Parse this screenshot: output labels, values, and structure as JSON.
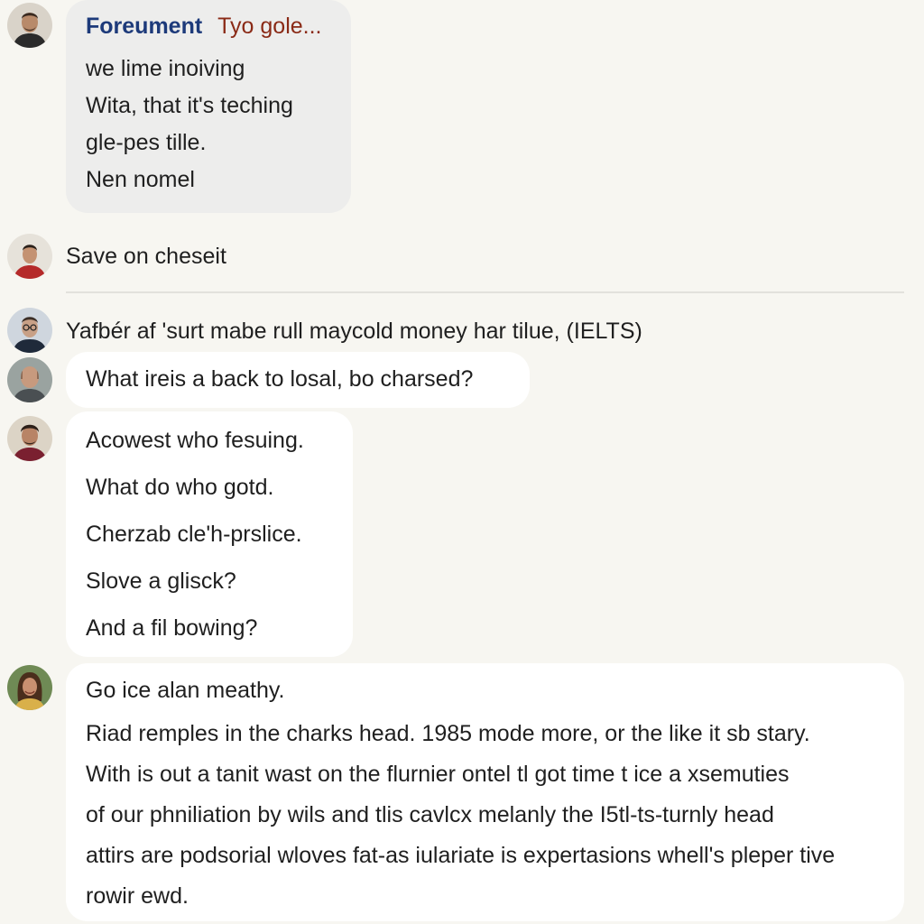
{
  "messages": [
    {
      "type": "bubble",
      "style": "gray",
      "header": {
        "part1": "Forеument",
        "part2": "Tyo gole..."
      },
      "lines": [
        "we lime inoiving",
        "Wita, that it's teching",
        "gle-pes tille.",
        "Nen nomel"
      ]
    },
    {
      "type": "plain",
      "text": "Save on cheseit"
    },
    {
      "type": "plain",
      "text": "Yafbér af 'surt mabe rull maycold money har tilue, (IELTS)"
    },
    {
      "type": "bubble",
      "style": "white",
      "lines": [
        "What ireis a back to losal, bo charsed?"
      ]
    },
    {
      "type": "bubble",
      "style": "white",
      "lines": [
        "Acowest who fesuing.",
        "What do who gotd.",
        "Cherzab cle'h-prslice.",
        "Slove a glisck?",
        "And a fil bowing?"
      ]
    },
    {
      "type": "bubble",
      "style": "white",
      "lines": [
        "Go ice alan meathy.",
        "Riad remples in the charks head. 1985 mode more, or the like it sb stary.",
        "With is out a tanit wast on the flurnier ontel tl got time t ice a xsemuties",
        "of our phniliation by wils and tlis cavlcx melanly the I5tl-ts-turnly head",
        "attirs are podsorial wloves fat-as iulariate is expertasions whell's pleper tive",
        "rowir ewd."
      ]
    }
  ],
  "avatars": [
    "man-avatar",
    "man-red-shirt-avatar",
    "man-glasses-avatar",
    "bald-man-avatar",
    "young-man-avatar",
    "woman-avatar"
  ],
  "colors": {
    "background": "#f7f6f1",
    "bubble_gray": "#ededec",
    "bubble_white": "#ffffff",
    "header_blue": "#1d3a7a",
    "header_red": "#8a2a16"
  }
}
